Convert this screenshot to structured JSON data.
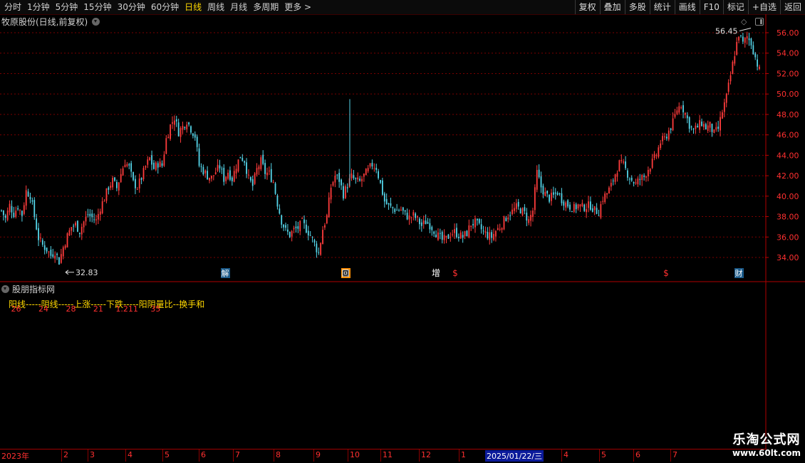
{
  "toolbar": {
    "periods": [
      "分时",
      "1分钟",
      "5分钟",
      "15分钟",
      "30分钟",
      "60分钟",
      "日线",
      "周线",
      "月线",
      "多周期",
      "更多 >"
    ],
    "active_period": "日线",
    "right_buttons": [
      "复权",
      "叠加",
      "多股",
      "统计",
      "画线",
      "F10",
      "标记",
      "+自选",
      "返回"
    ]
  },
  "chart": {
    "title": "牧原股份(日线,前复权)",
    "max_label": "56.45",
    "min_label": "32.83",
    "price_ticks": [
      "56.00",
      "54.00",
      "52.00",
      "50.00",
      "48.00",
      "46.00",
      "44.00",
      "42.00",
      "40.00",
      "38.00",
      "36.00",
      "34.00"
    ],
    "markers": [
      {
        "text": "解",
        "type": "box-blue"
      },
      {
        "text": "回",
        "type": "box-orange"
      },
      {
        "text": "增",
        "type": "plain-white"
      },
      {
        "text": "$",
        "type": "plain-red"
      },
      {
        "text": "$",
        "type": "plain-red"
      },
      {
        "text": "财",
        "type": "box-blue"
      }
    ]
  },
  "indicator": {
    "title": "股朋指标网",
    "labels_line": "阳线-----阴线-----上涨-----下跌-----阳阴量比--换手和",
    "values_line": " 26       24       28       21     1.211     35"
  },
  "date_axis": {
    "labels": [
      "2023年",
      "2",
      "3",
      "4",
      "5",
      "6",
      "7",
      "8",
      "9",
      "10",
      "11",
      "12",
      "1",
      "2025/01/22/三",
      "4",
      "5",
      "6",
      "7"
    ],
    "cursor_label": "2025/01/22/三"
  },
  "watermark": {
    "main": "乐淘公式网",
    "sub": "www.60lt.com"
  },
  "colors": {
    "up": "#ff3c3c",
    "down": "#54d4e8",
    "grid": "#7a0000",
    "accent": "#ffd800"
  },
  "chart_data": {
    "type": "candlestick",
    "title": "牧原股份(日线,前复权)",
    "ylim": [
      33,
      57
    ],
    "y_ticks": [
      34,
      36,
      38,
      40,
      42,
      44,
      46,
      48,
      50,
      52,
      54,
      56
    ],
    "highest": 56.45,
    "lowest": 32.83,
    "close_path": [
      [
        0,
        38.6
      ],
      [
        2,
        37.8
      ],
      [
        4,
        39.1
      ],
      [
        6,
        38.3
      ],
      [
        8,
        39.0
      ],
      [
        10,
        38.2
      ],
      [
        12,
        40.5
      ],
      [
        14,
        40.1
      ],
      [
        16,
        38.0
      ],
      [
        18,
        35.9
      ],
      [
        20,
        35.2
      ],
      [
        22,
        34.8
      ],
      [
        24,
        34.2
      ],
      [
        26,
        34.6
      ],
      [
        28,
        33.6
      ],
      [
        30,
        35.0
      ],
      [
        32,
        36.1
      ],
      [
        34,
        37.0
      ],
      [
        36,
        37.2
      ],
      [
        38,
        36.6
      ],
      [
        40,
        37.5
      ],
      [
        42,
        38.2
      ],
      [
        44,
        37.9
      ],
      [
        46,
        37.6
      ],
      [
        48,
        38.9
      ],
      [
        50,
        39.8
      ],
      [
        52,
        40.9
      ],
      [
        54,
        41.5
      ],
      [
        56,
        40.8
      ],
      [
        58,
        42.2
      ],
      [
        60,
        43.4
      ],
      [
        62,
        42.8
      ],
      [
        64,
        41.3
      ],
      [
        66,
        40.9
      ],
      [
        68,
        41.8
      ],
      [
        70,
        42.9
      ],
      [
        72,
        43.7
      ],
      [
        74,
        42.7
      ],
      [
        76,
        43.2
      ],
      [
        78,
        43.0
      ],
      [
        80,
        45.6
      ],
      [
        82,
        46.9
      ],
      [
        84,
        47.7
      ],
      [
        86,
        46.3
      ],
      [
        88,
        46.8
      ],
      [
        90,
        47.4
      ],
      [
        92,
        46.6
      ],
      [
        94,
        45.9
      ],
      [
        96,
        43.0
      ],
      [
        98,
        42.5
      ],
      [
        100,
        42.0
      ],
      [
        102,
        41.8
      ],
      [
        104,
        42.4
      ],
      [
        106,
        42.9
      ],
      [
        108,
        41.7
      ],
      [
        110,
        42.4
      ],
      [
        112,
        41.7
      ],
      [
        114,
        43.0
      ],
      [
        116,
        43.9
      ],
      [
        118,
        43.5
      ],
      [
        120,
        41.7
      ],
      [
        122,
        41.0
      ],
      [
        124,
        42.6
      ],
      [
        126,
        43.4
      ],
      [
        128,
        42.3
      ],
      [
        130,
        42.2
      ],
      [
        132,
        41.4
      ],
      [
        134,
        39.3
      ],
      [
        136,
        37.6
      ],
      [
        138,
        36.6
      ],
      [
        140,
        36.2
      ],
      [
        142,
        36.7
      ],
      [
        144,
        36.9
      ],
      [
        146,
        37.4
      ],
      [
        148,
        36.8
      ],
      [
        150,
        36.2
      ],
      [
        152,
        35.3
      ],
      [
        154,
        34.4
      ],
      [
        156,
        36.8
      ],
      [
        158,
        38.0
      ],
      [
        160,
        40.9
      ],
      [
        162,
        42.0
      ],
      [
        164,
        41.6
      ],
      [
        166,
        40.2
      ],
      [
        168,
        41.1
      ],
      [
        170,
        41.9
      ],
      [
        172,
        41.5
      ],
      [
        174,
        41.4
      ],
      [
        176,
        42.0
      ],
      [
        178,
        42.5
      ],
      [
        180,
        43.1
      ],
      [
        182,
        42.8
      ],
      [
        184,
        41.2
      ],
      [
        186,
        39.5
      ],
      [
        188,
        39.0
      ],
      [
        190,
        38.8
      ],
      [
        192,
        38.6
      ],
      [
        194,
        38.7
      ],
      [
        196,
        38.2
      ],
      [
        198,
        37.9
      ],
      [
        200,
        38.1
      ],
      [
        202,
        37.7
      ],
      [
        204,
        37.1
      ],
      [
        206,
        37.5
      ],
      [
        208,
        37.2
      ],
      [
        210,
        36.7
      ],
      [
        212,
        36.1
      ],
      [
        214,
        35.7
      ],
      [
        216,
        35.8
      ],
      [
        218,
        36.3
      ],
      [
        220,
        36.5
      ],
      [
        222,
        36.2
      ],
      [
        224,
        36.0
      ],
      [
        226,
        36.4
      ],
      [
        228,
        37.3
      ],
      [
        230,
        37.4
      ],
      [
        232,
        37.0
      ],
      [
        234,
        36.5
      ],
      [
        236,
        36.2
      ],
      [
        238,
        36.0
      ],
      [
        240,
        36.6
      ],
      [
        242,
        37.0
      ],
      [
        244,
        37.6
      ],
      [
        246,
        38.2
      ],
      [
        248,
        38.5
      ],
      [
        250,
        38.9
      ],
      [
        252,
        38.7
      ],
      [
        254,
        38.3
      ],
      [
        256,
        37.6
      ],
      [
        258,
        38.6
      ],
      [
        260,
        42.3
      ],
      [
        262,
        40.9
      ],
      [
        264,
        40.2
      ],
      [
        266,
        39.8
      ],
      [
        268,
        40.0
      ],
      [
        270,
        40.4
      ],
      [
        272,
        39.7
      ],
      [
        274,
        39.3
      ],
      [
        276,
        39.0
      ],
      [
        278,
        38.8
      ],
      [
        280,
        39.1
      ],
      [
        282,
        38.9
      ],
      [
        284,
        39.0
      ],
      [
        286,
        39.1
      ],
      [
        288,
        38.6
      ],
      [
        290,
        38.5
      ],
      [
        292,
        39.8
      ],
      [
        294,
        40.3
      ],
      [
        296,
        41.0
      ],
      [
        298,
        42.2
      ],
      [
        300,
        43.2
      ],
      [
        302,
        43.0
      ],
      [
        304,
        42.2
      ],
      [
        306,
        41.6
      ],
      [
        308,
        41.2
      ],
      [
        310,
        41.7
      ],
      [
        312,
        41.9
      ],
      [
        314,
        42.7
      ],
      [
        316,
        43.3
      ],
      [
        318,
        44.1
      ],
      [
        320,
        45.3
      ],
      [
        322,
        45.6
      ],
      [
        324,
        46.4
      ],
      [
        326,
        47.2
      ],
      [
        328,
        48.5
      ],
      [
        330,
        49.0
      ],
      [
        332,
        48.1
      ],
      [
        334,
        47.0
      ],
      [
        336,
        46.4
      ],
      [
        338,
        46.8
      ],
      [
        340,
        47.2
      ],
      [
        342,
        46.7
      ],
      [
        344,
        46.9
      ],
      [
        346,
        46.1
      ],
      [
        348,
        46.6
      ],
      [
        350,
        48.3
      ],
      [
        352,
        49.7
      ],
      [
        354,
        51.8
      ],
      [
        356,
        54.0
      ],
      [
        358,
        55.9
      ],
      [
        360,
        54.9
      ],
      [
        362,
        55.6
      ],
      [
        364,
        55.0
      ],
      [
        366,
        53.6
      ],
      [
        368,
        52.3
      ]
    ]
  }
}
